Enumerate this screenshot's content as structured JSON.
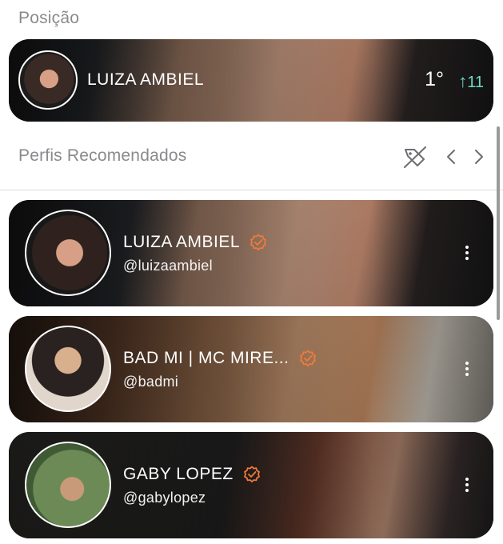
{
  "sections": {
    "position_title": "Posição",
    "recommended_title": "Perfis Recomendados"
  },
  "ranking": {
    "name": "LUIZA AMBIEL",
    "position": "1°",
    "change": "11",
    "change_icon": "arrow-up-icon",
    "change_color": "#6fd8c3"
  },
  "header_icons": {
    "tag_off": "tag-off-icon",
    "prev": "chevron-left-icon",
    "next": "chevron-right-icon"
  },
  "profiles": [
    {
      "name": "LUIZA AMBIEL",
      "handle": "@luizaambiel",
      "verified": true
    },
    {
      "name": "BAD MI | MC MIRE...",
      "handle": "@badmi",
      "verified": true
    },
    {
      "name": "GABY LOPEZ",
      "handle": "@gabylopez",
      "verified": true
    }
  ],
  "colors": {
    "verified_badge": "#f07a3a",
    "section_title": "#8a8a8e",
    "card_text": "#ffffff"
  }
}
